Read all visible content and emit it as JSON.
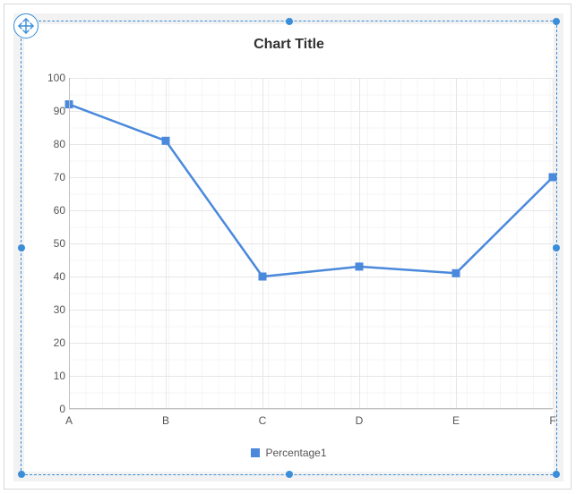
{
  "chart_data": {
    "type": "line",
    "title": "Chart Title",
    "categories": [
      "A",
      "B",
      "C",
      "D",
      "E",
      "F"
    ],
    "series": [
      {
        "name": "Percentage1",
        "values": [
          92,
          81,
          40,
          43,
          41,
          70
        ],
        "color": "#4a89dc"
      }
    ],
    "ylabel": "",
    "xlabel": "",
    "ylim": [
      0,
      100
    ],
    "yticks": [
      0,
      10,
      20,
      30,
      40,
      50,
      60,
      70,
      80,
      90,
      100
    ]
  },
  "legend": {
    "items": [
      {
        "label": "Percentage1",
        "color": "#4a89dc"
      }
    ]
  }
}
